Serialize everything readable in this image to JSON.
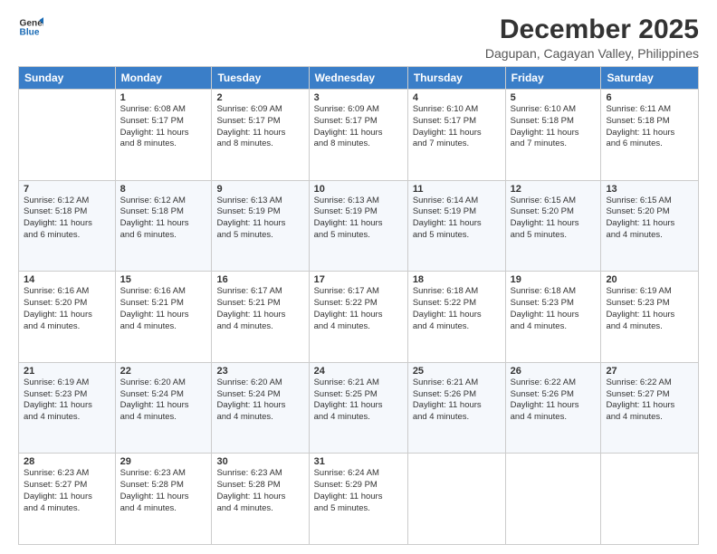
{
  "logo": {
    "line1": "General",
    "line2": "Blue"
  },
  "title": "December 2025",
  "location": "Dagupan, Cagayan Valley, Philippines",
  "weekdays": [
    "Sunday",
    "Monday",
    "Tuesday",
    "Wednesday",
    "Thursday",
    "Friday",
    "Saturday"
  ],
  "weeks": [
    [
      {
        "day": "",
        "info": ""
      },
      {
        "day": "1",
        "info": "Sunrise: 6:08 AM\nSunset: 5:17 PM\nDaylight: 11 hours\nand 8 minutes."
      },
      {
        "day": "2",
        "info": "Sunrise: 6:09 AM\nSunset: 5:17 PM\nDaylight: 11 hours\nand 8 minutes."
      },
      {
        "day": "3",
        "info": "Sunrise: 6:09 AM\nSunset: 5:17 PM\nDaylight: 11 hours\nand 8 minutes."
      },
      {
        "day": "4",
        "info": "Sunrise: 6:10 AM\nSunset: 5:17 PM\nDaylight: 11 hours\nand 7 minutes."
      },
      {
        "day": "5",
        "info": "Sunrise: 6:10 AM\nSunset: 5:18 PM\nDaylight: 11 hours\nand 7 minutes."
      },
      {
        "day": "6",
        "info": "Sunrise: 6:11 AM\nSunset: 5:18 PM\nDaylight: 11 hours\nand 6 minutes."
      }
    ],
    [
      {
        "day": "7",
        "info": "Sunrise: 6:12 AM\nSunset: 5:18 PM\nDaylight: 11 hours\nand 6 minutes."
      },
      {
        "day": "8",
        "info": "Sunrise: 6:12 AM\nSunset: 5:18 PM\nDaylight: 11 hours\nand 6 minutes."
      },
      {
        "day": "9",
        "info": "Sunrise: 6:13 AM\nSunset: 5:19 PM\nDaylight: 11 hours\nand 5 minutes."
      },
      {
        "day": "10",
        "info": "Sunrise: 6:13 AM\nSunset: 5:19 PM\nDaylight: 11 hours\nand 5 minutes."
      },
      {
        "day": "11",
        "info": "Sunrise: 6:14 AM\nSunset: 5:19 PM\nDaylight: 11 hours\nand 5 minutes."
      },
      {
        "day": "12",
        "info": "Sunrise: 6:15 AM\nSunset: 5:20 PM\nDaylight: 11 hours\nand 5 minutes."
      },
      {
        "day": "13",
        "info": "Sunrise: 6:15 AM\nSunset: 5:20 PM\nDaylight: 11 hours\nand 4 minutes."
      }
    ],
    [
      {
        "day": "14",
        "info": "Sunrise: 6:16 AM\nSunset: 5:20 PM\nDaylight: 11 hours\nand 4 minutes."
      },
      {
        "day": "15",
        "info": "Sunrise: 6:16 AM\nSunset: 5:21 PM\nDaylight: 11 hours\nand 4 minutes."
      },
      {
        "day": "16",
        "info": "Sunrise: 6:17 AM\nSunset: 5:21 PM\nDaylight: 11 hours\nand 4 minutes."
      },
      {
        "day": "17",
        "info": "Sunrise: 6:17 AM\nSunset: 5:22 PM\nDaylight: 11 hours\nand 4 minutes."
      },
      {
        "day": "18",
        "info": "Sunrise: 6:18 AM\nSunset: 5:22 PM\nDaylight: 11 hours\nand 4 minutes."
      },
      {
        "day": "19",
        "info": "Sunrise: 6:18 AM\nSunset: 5:23 PM\nDaylight: 11 hours\nand 4 minutes."
      },
      {
        "day": "20",
        "info": "Sunrise: 6:19 AM\nSunset: 5:23 PM\nDaylight: 11 hours\nand 4 minutes."
      }
    ],
    [
      {
        "day": "21",
        "info": "Sunrise: 6:19 AM\nSunset: 5:23 PM\nDaylight: 11 hours\nand 4 minutes."
      },
      {
        "day": "22",
        "info": "Sunrise: 6:20 AM\nSunset: 5:24 PM\nDaylight: 11 hours\nand 4 minutes."
      },
      {
        "day": "23",
        "info": "Sunrise: 6:20 AM\nSunset: 5:24 PM\nDaylight: 11 hours\nand 4 minutes."
      },
      {
        "day": "24",
        "info": "Sunrise: 6:21 AM\nSunset: 5:25 PM\nDaylight: 11 hours\nand 4 minutes."
      },
      {
        "day": "25",
        "info": "Sunrise: 6:21 AM\nSunset: 5:26 PM\nDaylight: 11 hours\nand 4 minutes."
      },
      {
        "day": "26",
        "info": "Sunrise: 6:22 AM\nSunset: 5:26 PM\nDaylight: 11 hours\nand 4 minutes."
      },
      {
        "day": "27",
        "info": "Sunrise: 6:22 AM\nSunset: 5:27 PM\nDaylight: 11 hours\nand 4 minutes."
      }
    ],
    [
      {
        "day": "28",
        "info": "Sunrise: 6:23 AM\nSunset: 5:27 PM\nDaylight: 11 hours\nand 4 minutes."
      },
      {
        "day": "29",
        "info": "Sunrise: 6:23 AM\nSunset: 5:28 PM\nDaylight: 11 hours\nand 4 minutes."
      },
      {
        "day": "30",
        "info": "Sunrise: 6:23 AM\nSunset: 5:28 PM\nDaylight: 11 hours\nand 4 minutes."
      },
      {
        "day": "31",
        "info": "Sunrise: 6:24 AM\nSunset: 5:29 PM\nDaylight: 11 hours\nand 5 minutes."
      },
      {
        "day": "",
        "info": ""
      },
      {
        "day": "",
        "info": ""
      },
      {
        "day": "",
        "info": ""
      }
    ]
  ]
}
